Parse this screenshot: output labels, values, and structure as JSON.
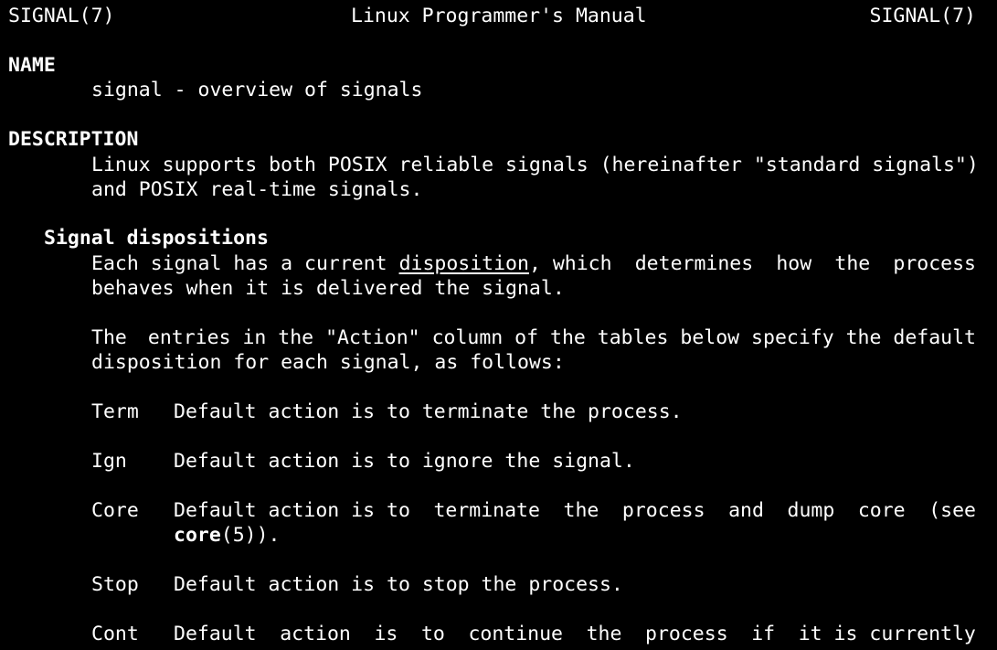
{
  "header": {
    "left": "SIGNAL(7)",
    "center": "Linux Programmer's Manual",
    "right": "SIGNAL(7)"
  },
  "name_section": {
    "heading": "NAME",
    "text": "signal - overview of signals"
  },
  "description_section": {
    "heading": "DESCRIPTION",
    "line1": "Linux supports both POSIX reliable signals (hereinafter \"standard signals\")",
    "line2": "and POSIX real-time signals."
  },
  "dispositions": {
    "heading": "Signal dispositions",
    "p1_line1_prefix": "Each signal has a current",
    "p1_line1_term": "disposition",
    "p1_line1_words": [
      ", which",
      "determines",
      "how",
      "the",
      "process"
    ],
    "p1_line2": "behaves when it is delivered the signal.",
    "p2_line1_words": [
      "The",
      "entries in the \"Action\" column of the tables below specify the default"
    ],
    "p2_line2": "disposition for each signal, as follows:"
  },
  "actions": [
    {
      "tag": "Term",
      "text": "Default action is to terminate the process."
    },
    {
      "tag": "Ign",
      "text": "Default action is to ignore the signal."
    },
    {
      "tag": "Core",
      "words": [
        "Default action is to",
        "terminate",
        "the",
        "process",
        "and",
        "dump",
        "core",
        "(see"
      ],
      "line2_bold": "core",
      "line2_rest": "(5))."
    },
    {
      "tag": "Stop",
      "text": "Default action is to stop the process."
    },
    {
      "tag": "Cont",
      "words": [
        "Default",
        "action",
        "is",
        "to",
        "continue",
        "the",
        "process",
        "if",
        "it is currently"
      ]
    }
  ],
  "colors": {
    "background": "#000000",
    "foreground": "#ffffff"
  }
}
